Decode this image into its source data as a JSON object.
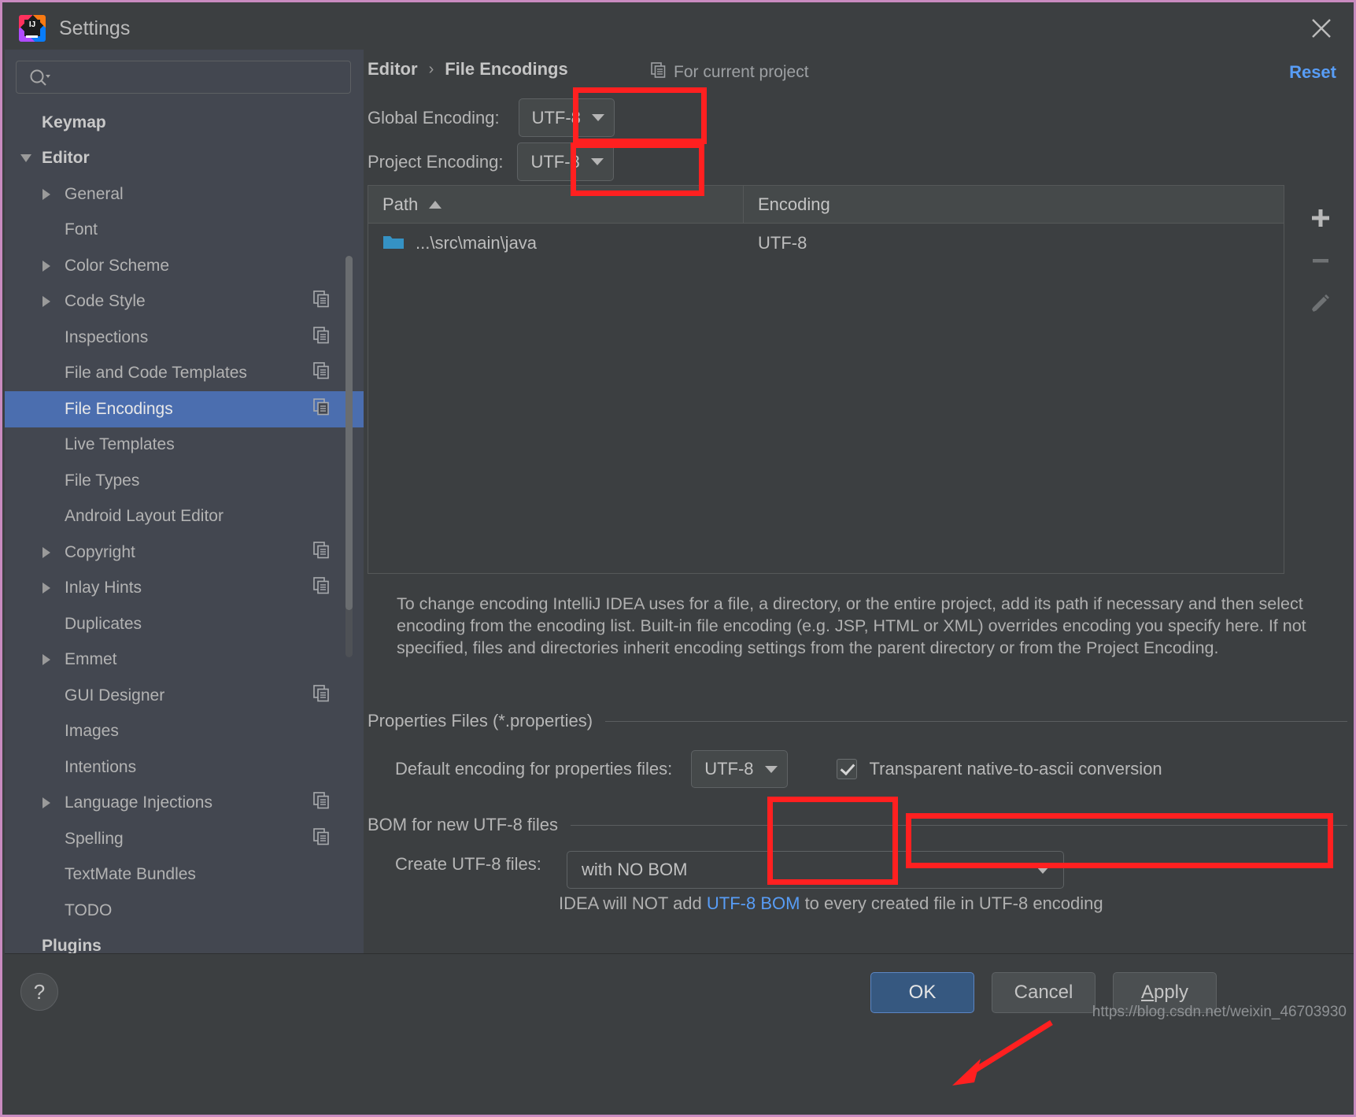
{
  "window": {
    "title": "Settings",
    "logo_text": "IJ",
    "close_label": "×"
  },
  "search": {
    "value": "",
    "placeholder": ""
  },
  "sidebar": {
    "items": [
      {
        "label": "Keymap",
        "level": "root",
        "arrow": "none",
        "copy": false,
        "selected": false
      },
      {
        "label": "Editor",
        "level": "root",
        "arrow": "down",
        "copy": false,
        "selected": false
      },
      {
        "label": "General",
        "level": "lvl1",
        "arrow": "right",
        "copy": false,
        "selected": false
      },
      {
        "label": "Font",
        "level": "lvl1",
        "arrow": "none",
        "copy": false,
        "selected": false
      },
      {
        "label": "Color Scheme",
        "level": "lvl1",
        "arrow": "right",
        "copy": false,
        "selected": false
      },
      {
        "label": "Code Style",
        "level": "lvl1",
        "arrow": "right",
        "copy": true,
        "selected": false
      },
      {
        "label": "Inspections",
        "level": "lvl1",
        "arrow": "none",
        "copy": true,
        "selected": false
      },
      {
        "label": "File and Code Templates",
        "level": "lvl1",
        "arrow": "none",
        "copy": true,
        "selected": false
      },
      {
        "label": "File Encodings",
        "level": "lvl1",
        "arrow": "none",
        "copy": true,
        "selected": true
      },
      {
        "label": "Live Templates",
        "level": "lvl1",
        "arrow": "none",
        "copy": false,
        "selected": false
      },
      {
        "label": "File Types",
        "level": "lvl1",
        "arrow": "none",
        "copy": false,
        "selected": false
      },
      {
        "label": "Android Layout Editor",
        "level": "lvl1",
        "arrow": "none",
        "copy": false,
        "selected": false
      },
      {
        "label": "Copyright",
        "level": "lvl1",
        "arrow": "right",
        "copy": true,
        "selected": false
      },
      {
        "label": "Inlay Hints",
        "level": "lvl1",
        "arrow": "right",
        "copy": true,
        "selected": false
      },
      {
        "label": "Duplicates",
        "level": "lvl1",
        "arrow": "none",
        "copy": false,
        "selected": false
      },
      {
        "label": "Emmet",
        "level": "lvl1",
        "arrow": "right",
        "copy": false,
        "selected": false
      },
      {
        "label": "GUI Designer",
        "level": "lvl1",
        "arrow": "none",
        "copy": true,
        "selected": false
      },
      {
        "label": "Images",
        "level": "lvl1",
        "arrow": "none",
        "copy": false,
        "selected": false
      },
      {
        "label": "Intentions",
        "level": "lvl1",
        "arrow": "none",
        "copy": false,
        "selected": false
      },
      {
        "label": "Language Injections",
        "level": "lvl1",
        "arrow": "right",
        "copy": true,
        "selected": false
      },
      {
        "label": "Spelling",
        "level": "lvl1",
        "arrow": "none",
        "copy": true,
        "selected": false
      },
      {
        "label": "TextMate Bundles",
        "level": "lvl1",
        "arrow": "none",
        "copy": false,
        "selected": false
      },
      {
        "label": "TODO",
        "level": "lvl1",
        "arrow": "none",
        "copy": false,
        "selected": false
      },
      {
        "label": "Plugins",
        "level": "root",
        "arrow": "none",
        "copy": false,
        "selected": false
      }
    ]
  },
  "main": {
    "breadcrumb": {
      "parent": "Editor",
      "separator": "›",
      "current": "File Encodings"
    },
    "for_current_project": "For current project",
    "reset_label": "Reset",
    "global_encoding": {
      "label": "Global Encoding:",
      "value": "UTF-8"
    },
    "project_encoding": {
      "label": "Project Encoding:",
      "value": "UTF-8"
    },
    "table": {
      "columns": [
        "Path",
        "Encoding"
      ],
      "sort_column": "Path",
      "sort_direction": "asc",
      "rows": [
        {
          "path": "...\\src\\main\\java",
          "encoding": "UTF-8"
        }
      ]
    },
    "toolbar": {
      "add_label": "+",
      "remove_label": "−",
      "edit_label": "edit"
    },
    "description": "To change encoding IntelliJ IDEA uses for a file, a directory, or the entire project, add its path if necessary and then select encoding from the encoding list. Built-in file encoding (e.g. JSP, HTML or XML) overrides encoding you specify here. If not specified, files and directories inherit encoding settings from the parent directory or from the Project Encoding.",
    "properties_group": {
      "title": "Properties Files (*.properties)",
      "default_encoding_label": "Default encoding for properties files:",
      "default_encoding_value": "UTF-8",
      "transparent_label": "Transparent native-to-ascii conversion",
      "transparent_checked": true
    },
    "bom_group": {
      "title": "BOM for new UTF-8 files",
      "create_label": "Create UTF-8 files:",
      "create_value": "with NO BOM",
      "note_prefix": "IDEA will NOT add ",
      "note_link": "UTF-8 BOM",
      "note_suffix": " to every created file in UTF-8 encoding"
    }
  },
  "footer": {
    "help_label": "?",
    "ok_label": "OK",
    "cancel_label": "Cancel",
    "apply_prefix": "A",
    "apply_rest": "pply",
    "watermark": "https://blog.csdn.net/weixin_46703930"
  },
  "colors": {
    "accent_blue": "#4b6eaf",
    "link_blue": "#589df6",
    "annotation_red": "#ff2020",
    "window_bg": "#3c3f41",
    "sidebar_bg": "#434750",
    "ok_button": "#365880"
  }
}
